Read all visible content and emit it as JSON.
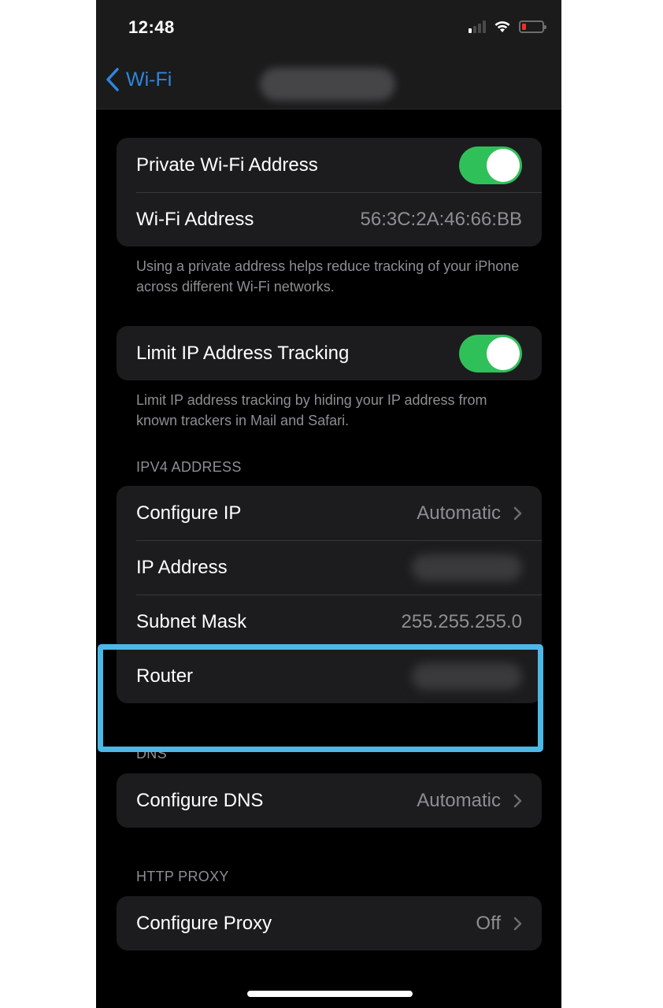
{
  "status_bar": {
    "time": "12:48",
    "signal_bars_active": 1,
    "signal_bars_total": 4,
    "wifi_icon": "wifi-icon",
    "battery_level_percent": 10,
    "battery_color": "#e8332e"
  },
  "nav": {
    "back_label": "Wi-Fi",
    "back_icon": "chevron-left-icon",
    "title": "",
    "accent_color": "#2e86de"
  },
  "privacy_group": {
    "rows": [
      {
        "label": "Private Wi-Fi Address",
        "toggle_on": true
      },
      {
        "label": "Wi-Fi Address",
        "value": "56:3C:2A:46:66:BB"
      }
    ],
    "footer": "Using a private address helps reduce tracking of your iPhone across different Wi-Fi networks."
  },
  "tracking_group": {
    "rows": [
      {
        "label": "Limit IP Address Tracking",
        "toggle_on": true
      }
    ],
    "footer": "Limit IP address tracking by hiding your IP address from known trackers in Mail and Safari."
  },
  "ipv4_group": {
    "header": "IPV4 ADDRESS",
    "rows": [
      {
        "label": "Configure IP",
        "value": "Automatic",
        "chevron": true
      },
      {
        "label": "IP Address",
        "value_redacted": true
      },
      {
        "label": "Subnet Mask",
        "value": "255.255.255.0"
      },
      {
        "label": "Router",
        "value_redacted": true
      }
    ]
  },
  "dns_group": {
    "header": "DNS",
    "rows": [
      {
        "label": "Configure DNS",
        "value": "Automatic",
        "chevron": true
      }
    ]
  },
  "proxy_group": {
    "header": "HTTP PROXY",
    "rows": [
      {
        "label": "Configure Proxy",
        "value": "Off",
        "chevron": true
      }
    ]
  },
  "annotation": {
    "highlight_target": "Router",
    "color": "#4db8e6"
  },
  "colors": {
    "toggle_on": "#30c05a",
    "cell_background": "#1c1c1e",
    "background": "#000000"
  }
}
